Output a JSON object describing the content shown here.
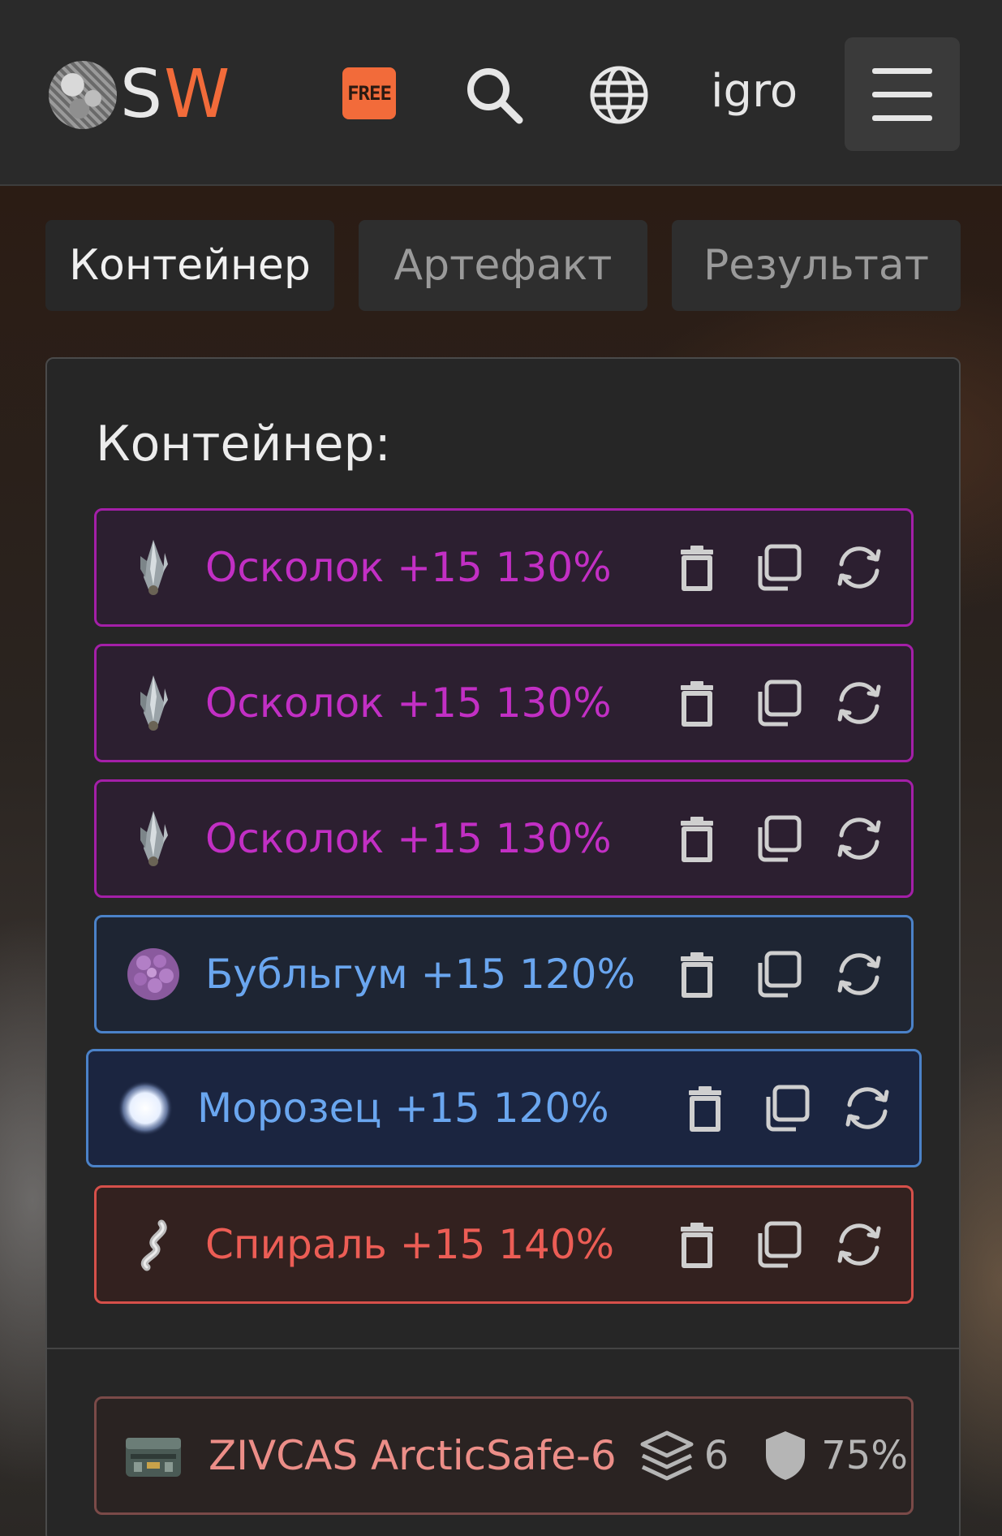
{
  "header": {
    "logo_text_s": "S",
    "logo_text_w": "W",
    "free_badge": "FREE",
    "username": "igro",
    "icons": [
      "search-icon",
      "globe-icon",
      "menu-icon"
    ],
    "accent_color": "#f26b3a"
  },
  "tabs": [
    {
      "label": "Контейнер",
      "active": true
    },
    {
      "label": "Артефакт",
      "active": false
    },
    {
      "label": "Результат",
      "active": false
    }
  ],
  "panel": {
    "title": "Контейнер:",
    "items": [
      {
        "label": "Осколок +15 130%",
        "rarity": "purple",
        "icon": "shard-icon"
      },
      {
        "label": "Осколок +15 130%",
        "rarity": "purple",
        "icon": "shard-icon"
      },
      {
        "label": "Осколок +15 130%",
        "rarity": "purple",
        "icon": "shard-icon"
      },
      {
        "label": "Бубльгум +15 120%",
        "rarity": "blue",
        "icon": "bubblegum-icon"
      },
      {
        "label": "Морозец +15 120%",
        "rarity": "blue",
        "icon": "frost-icon",
        "selected": true
      },
      {
        "label": "Спираль +15 140%",
        "rarity": "red",
        "icon": "spiral-icon"
      }
    ],
    "item_actions": [
      "delete-icon",
      "copy-icon",
      "reroll-icon"
    ],
    "container": {
      "name": "ZIVCAS ArcticSafe-6",
      "slots": "6",
      "protection": "75%"
    }
  },
  "colors": {
    "purple": "#a41fa8",
    "blue": "#4b82c8",
    "red": "#d6504a"
  }
}
